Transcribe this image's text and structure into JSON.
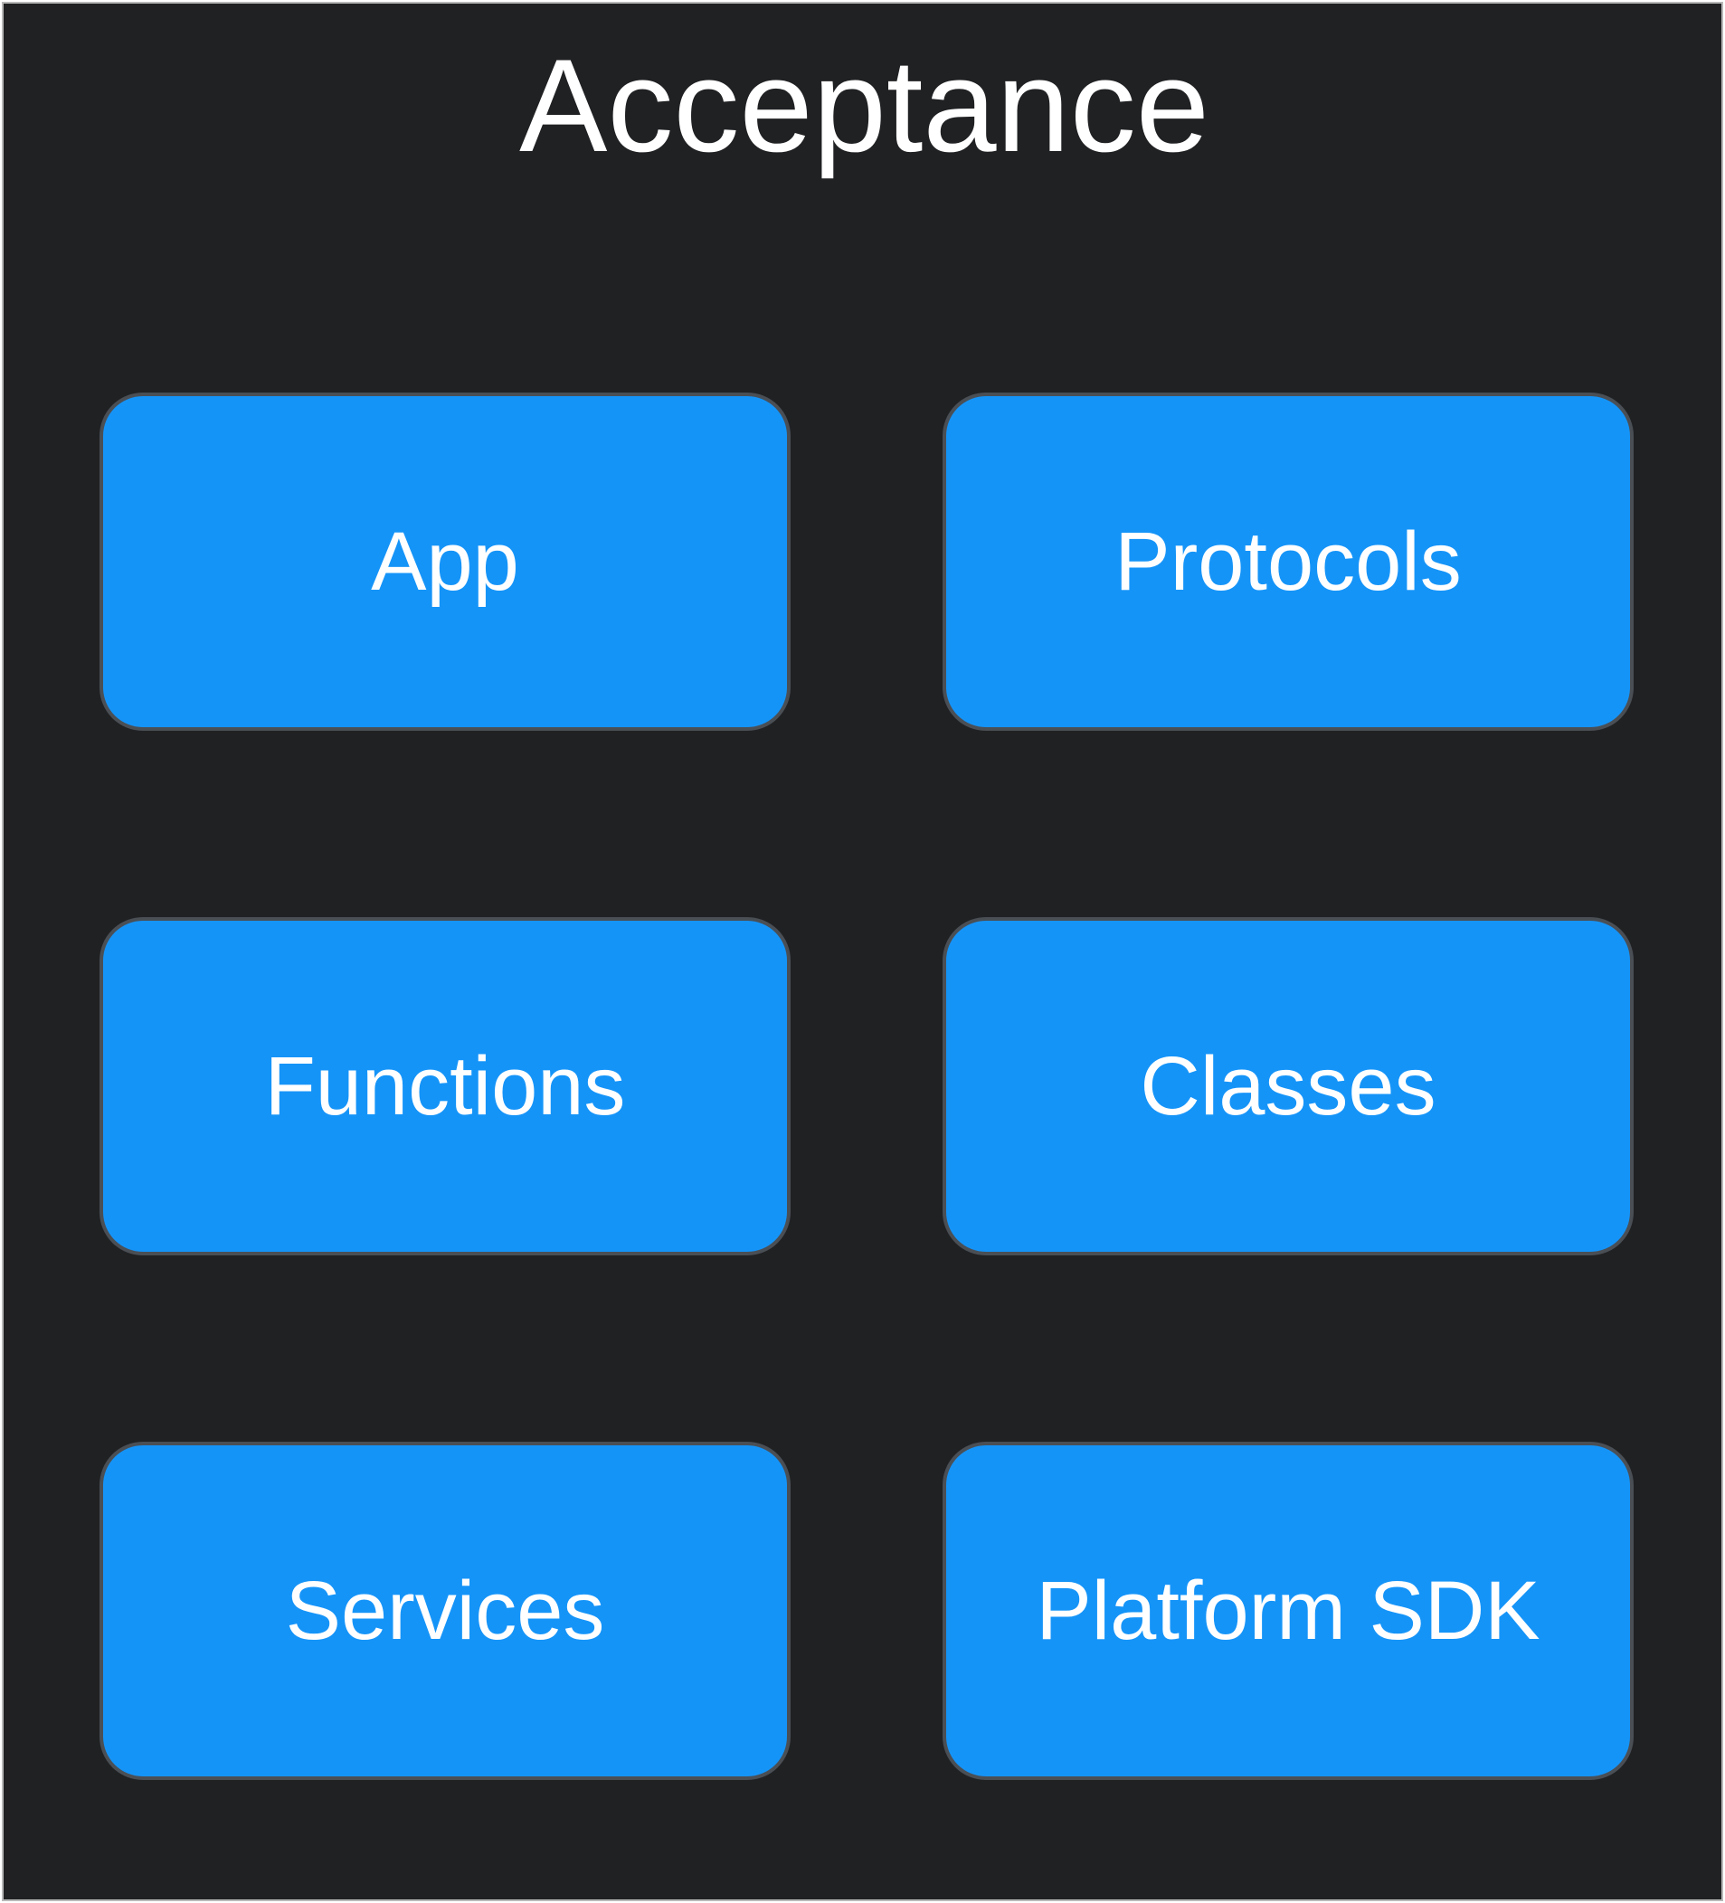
{
  "diagram": {
    "title": "Acceptance",
    "colors": {
      "background": "#202123",
      "box_fill": "#1594f8",
      "box_border": "#4a4f55",
      "text": "#ffffff"
    },
    "boxes": [
      {
        "label": "App"
      },
      {
        "label": "Protocols"
      },
      {
        "label": "Functions"
      },
      {
        "label": "Classes"
      },
      {
        "label": "Services"
      },
      {
        "label": "Platform SDK"
      }
    ]
  }
}
